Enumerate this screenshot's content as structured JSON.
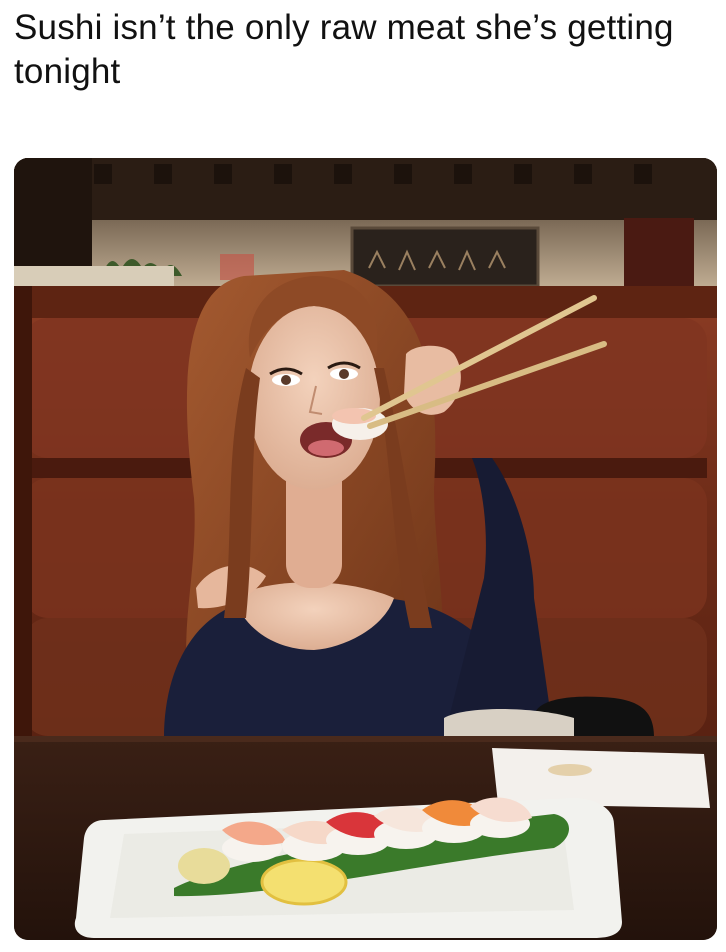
{
  "meme": {
    "caption": "Sushi isn’t the only raw meat she’s getting tonight"
  },
  "photo": {
    "subject": "woman-eating-sushi-with-chopsticks",
    "setting": "restaurant-booth",
    "colors": {
      "booth": "#7a3320",
      "table": "#2d1810",
      "sweater": "#1a1f3a",
      "hair": "#8a4a28",
      "plate": "#f2f2ee"
    }
  }
}
